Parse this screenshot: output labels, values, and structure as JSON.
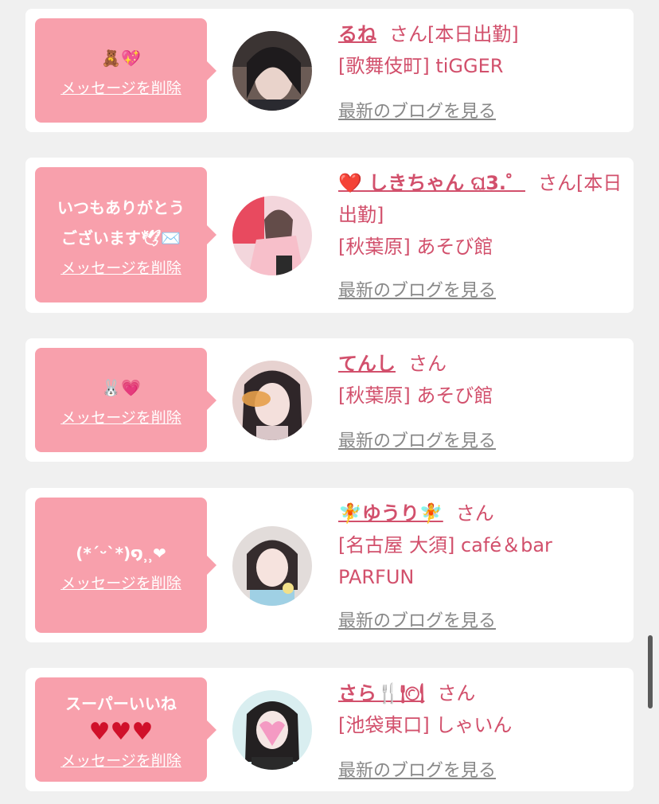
{
  "colors": {
    "bubble": "#f8a0ac",
    "accent": "#d2506c",
    "link": "#888888",
    "background": "#f0f0f0"
  },
  "cards": [
    {
      "message": "🧸💖",
      "delete_label": "メッセージを削除",
      "name": "るね",
      "suffix": "さん[本日出勤]",
      "shop": "[歌舞伎町] tiGGER",
      "blog_label": "最新のブログを見る"
    },
    {
      "message_line1": "いつもありがとう",
      "message_line2": "ございます🕊✉️",
      "delete_label": "メッセージを削除",
      "name": "❤️ しきちゃん ଘ3.゜",
      "suffix": "さん[本日出勤]",
      "shop": "[秋葉原] あそび館",
      "blog_label": "最新のブログを見る"
    },
    {
      "message": "🐰💗",
      "delete_label": "メッセージを削除",
      "name": "てんし",
      "suffix": "さん",
      "shop": "[秋葉原] あそび館",
      "blog_label": "最新のブログを見る"
    },
    {
      "message": "(*´ᵕ`*)໑⸒⸒❤",
      "delete_label": "メッセージを削除",
      "name": "🧚ゆうり🧚",
      "suffix": "さん",
      "shop": "[名古屋 大須] café＆bar PARFUN",
      "blog_label": "最新のブログを見る"
    },
    {
      "message_line1": "スーパーいいね",
      "message_line2": "♥♥♥",
      "delete_label": "メッセージを削除",
      "name": "さら🍴🍽",
      "suffix": "さん",
      "shop": "[池袋東口] しゃいん",
      "blog_label": "最新のブログを見る"
    }
  ]
}
